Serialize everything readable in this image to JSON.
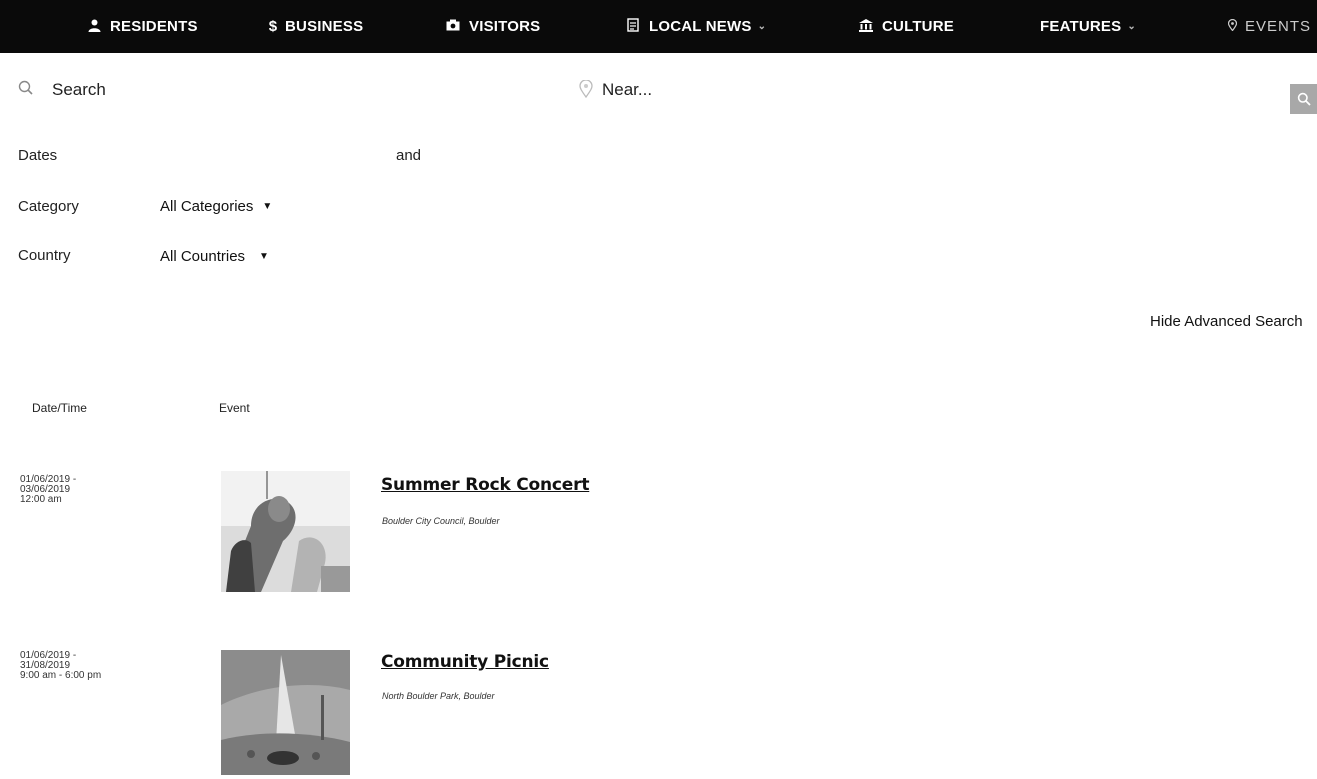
{
  "nav": {
    "items": [
      {
        "label": "RESIDENTS",
        "icon": "user-icon"
      },
      {
        "label": "BUSINESS",
        "icon": "dollar-icon"
      },
      {
        "label": "VISITORS",
        "icon": "camera-icon"
      },
      {
        "label": "LOCAL NEWS",
        "icon": "newspaper-icon",
        "dropdown": true
      },
      {
        "label": "CULTURE",
        "icon": "bank-icon"
      },
      {
        "label": "FEATURES",
        "icon": "",
        "dropdown": true
      },
      {
        "label": "EVENTS",
        "icon": "map-pin-icon"
      }
    ]
  },
  "search": {
    "placeholder": "Search",
    "near_placeholder": "Near..."
  },
  "filters": {
    "dates_label": "Dates",
    "and_label": "and",
    "category_label": "Category",
    "category_value": "All Categories",
    "country_label": "Country",
    "country_value": "All Countries",
    "hide_advanced": "Hide Advanced Search"
  },
  "table": {
    "headers": [
      "Date/Time",
      "Event"
    ],
    "rows": [
      {
        "date_lines": [
          "01/06/2019 -",
          "03/06/2019",
          "12:00 am"
        ],
        "title": "Summer Rock Concert",
        "location": "Boulder City Council, Boulder"
      },
      {
        "date_lines": [
          "01/06/2019 -",
          "31/08/2019",
          "9:00 am - 6:00 pm"
        ],
        "title": "Community Picnic",
        "location": "North Boulder Park, Boulder"
      }
    ]
  },
  "colors": {
    "nav_bg": "#0a0a0a",
    "nav_text": "#ffffff",
    "search_button": "#a8a8a8"
  }
}
